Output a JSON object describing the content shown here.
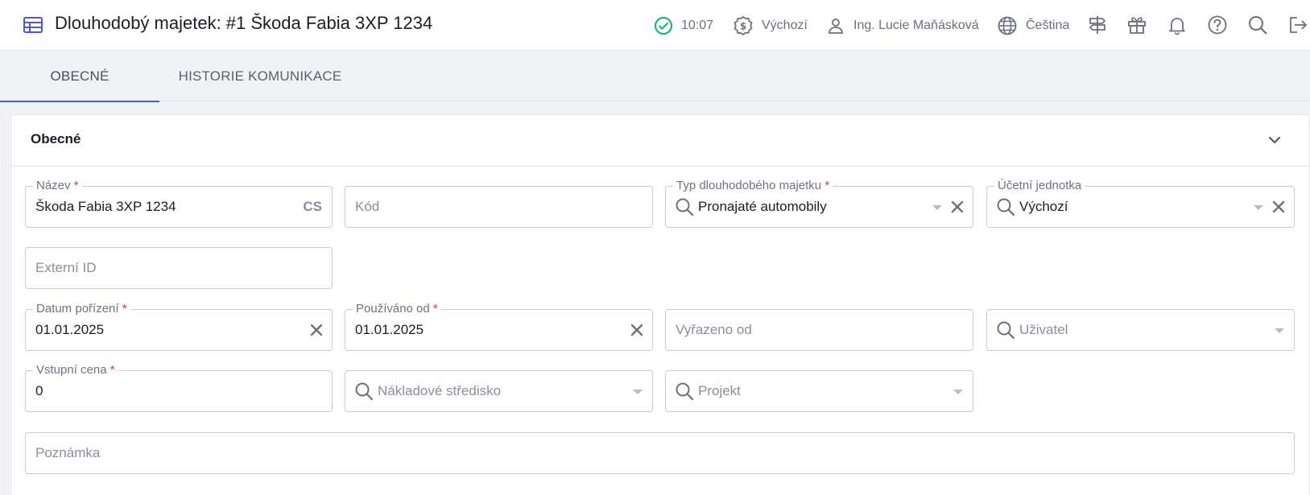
{
  "header": {
    "title": "Dlouhodobý majetek: #1 Škoda Fabia 3XP 1234",
    "time": "10:07",
    "currency_profile": "Výchozí",
    "user": "Ing. Lucie Maňásková",
    "language": "Čeština"
  },
  "tabs": [
    {
      "label": "OBECNÉ",
      "active": true
    },
    {
      "label": "HISTORIE KOMUNIKACE",
      "active": false
    }
  ],
  "section": {
    "title": "Obecné"
  },
  "fields": {
    "nazev": {
      "label": "Název",
      "value": "Škoda Fabia 3XP 1234",
      "lang": "CS"
    },
    "kod": {
      "placeholder": "Kód"
    },
    "typ": {
      "label": "Typ dlouhodobého majetku",
      "value": "Pronajaté automobily"
    },
    "ucetni_jednotka": {
      "label": "Účetní jednotka",
      "value": "Výchozí"
    },
    "externi_id": {
      "placeholder": "Externí ID"
    },
    "datum_porizeni": {
      "label": "Datum pořízení",
      "value": "01.01.2025"
    },
    "pouzivano_od": {
      "label": "Používáno od",
      "value": "01.01.2025"
    },
    "vyrazeno_od": {
      "placeholder": "Vyřazeno od"
    },
    "uzivatel": {
      "placeholder": "Uživatel"
    },
    "vstupni_cena": {
      "label": "Vstupní cena",
      "value": "0"
    },
    "nakladove_stredisko": {
      "placeholder": "Nákladové středisko"
    },
    "projekt": {
      "placeholder": "Projekt"
    },
    "poznamka": {
      "placeholder": "Poznámka"
    }
  },
  "colors": {
    "accent": "#4a5ad8",
    "required": "#e0353d",
    "online": "#22b573"
  }
}
